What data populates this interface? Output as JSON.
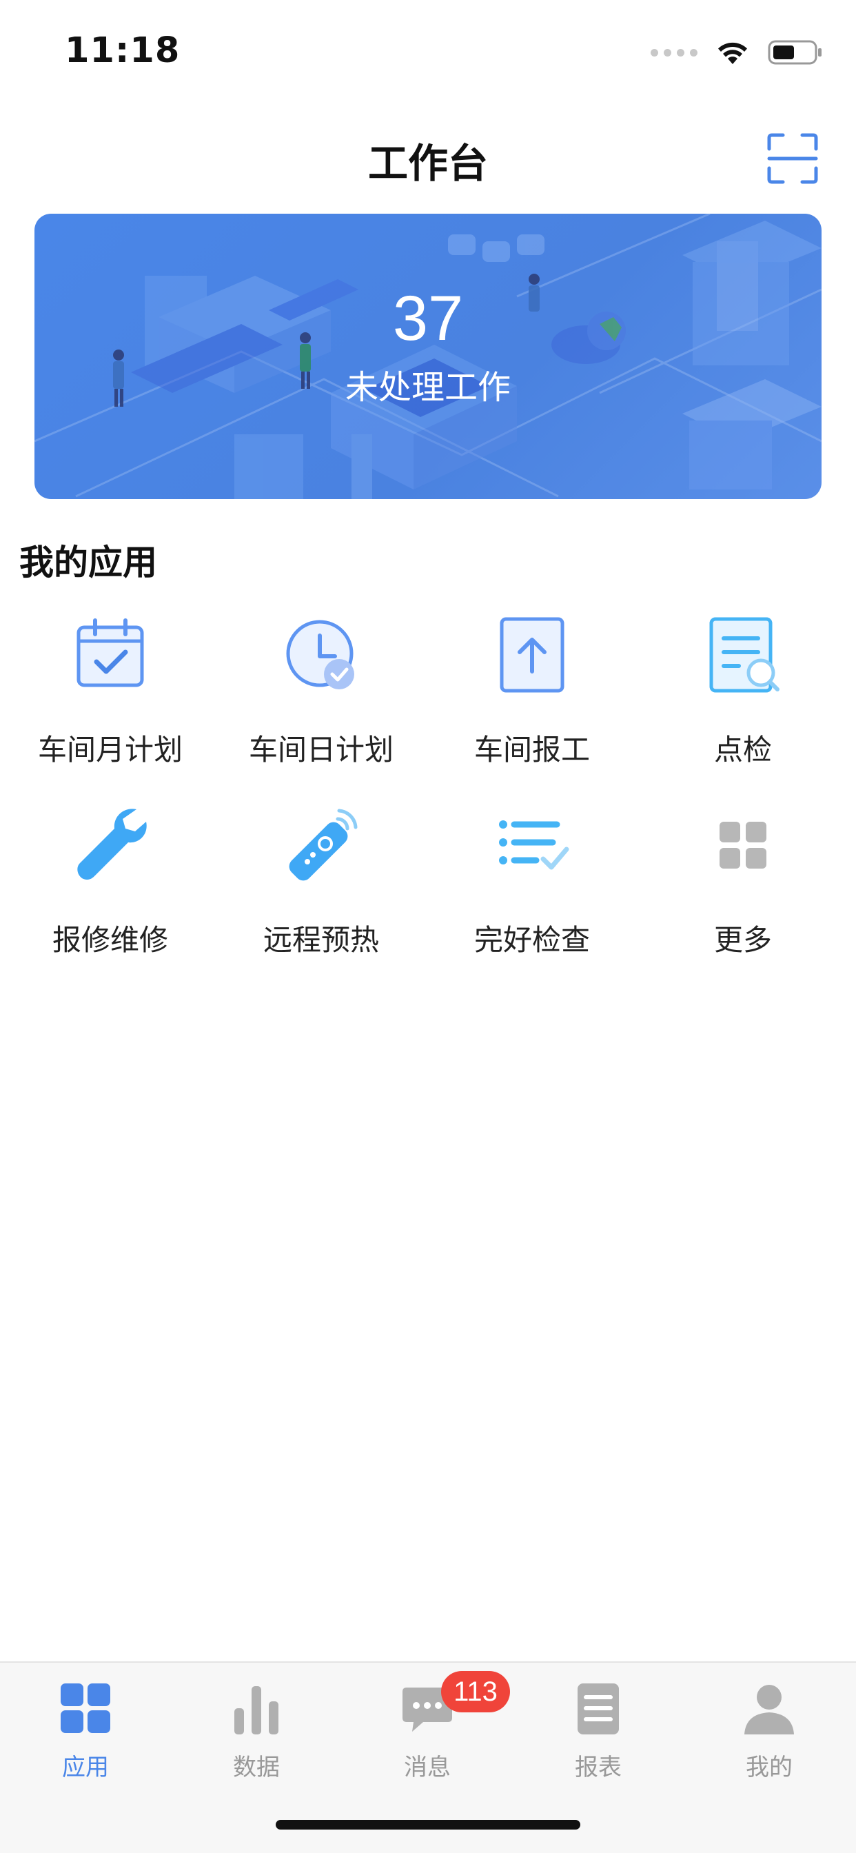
{
  "status_bar": {
    "time": "11:18"
  },
  "nav": {
    "title": "工作台"
  },
  "banner": {
    "count": "37",
    "label": "未处理工作"
  },
  "section": {
    "title": "我的应用"
  },
  "apps": [
    {
      "label": "车间月计划",
      "icon": "calendar-check-icon"
    },
    {
      "label": "车间日计划",
      "icon": "clock-check-icon"
    },
    {
      "label": "车间报工",
      "icon": "upload-report-icon"
    },
    {
      "label": "点检",
      "icon": "document-search-icon"
    },
    {
      "label": "报修维修",
      "icon": "wrench-icon"
    },
    {
      "label": "远程预热",
      "icon": "remote-control-icon"
    },
    {
      "label": "完好检查",
      "icon": "checklist-icon"
    },
    {
      "label": "更多",
      "icon": "grid-more-icon"
    }
  ],
  "tabs": [
    {
      "label": "应用",
      "icon": "apps-grid-icon",
      "active": true
    },
    {
      "label": "数据",
      "icon": "bar-chart-icon"
    },
    {
      "label": "消息",
      "icon": "chat-bubble-icon",
      "badge": "113"
    },
    {
      "label": "报表",
      "icon": "report-list-icon"
    },
    {
      "label": "我的",
      "icon": "person-icon"
    }
  ],
  "colors": {
    "primary": "#4a86e8",
    "badge": "#f0443a",
    "inactive": "#999999",
    "icon_light": "#4aa8ff"
  }
}
